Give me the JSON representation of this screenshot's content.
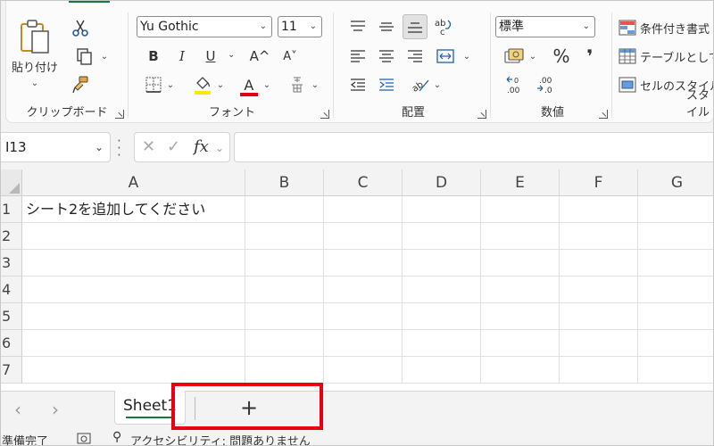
{
  "ribbon": {
    "clipboard": {
      "label": "クリップボード",
      "paste_label": "貼り付け"
    },
    "font": {
      "label": "フォント",
      "font_name": "Yu Gothic",
      "font_size": "11",
      "bold": "B",
      "italic": "I",
      "underline": "U",
      "grow": "A^",
      "shrink": "A˅",
      "font_color_letter": "A",
      "highlight_color": "#ffe600",
      "font_color": "#e60012"
    },
    "alignment": {
      "label": "配置"
    },
    "number": {
      "label": "数値",
      "format": "標準",
      "percent": "%",
      "comma": "❜"
    },
    "styles": {
      "label": "スタイル",
      "conditional": "条件付き書式",
      "table": "テーブルとして書",
      "cell_styles": "セルのスタイル"
    }
  },
  "formula_bar": {
    "name_box": "I13",
    "fx": "fx"
  },
  "grid": {
    "columns": [
      "A",
      "B",
      "C",
      "D",
      "E",
      "F",
      "G"
    ],
    "rows": [
      "1",
      "2",
      "3",
      "4",
      "5",
      "6",
      "7"
    ],
    "cell_a1": "シート2を追加してください"
  },
  "sheets": {
    "tabs": [
      "Sheet1"
    ],
    "add": "+",
    "highlight_color": "#e60012"
  },
  "status": {
    "ready": "準備完了",
    "accessibility": "アクセシビリティ: 問題ありません"
  },
  "colors": {
    "accent": "#107c41"
  }
}
